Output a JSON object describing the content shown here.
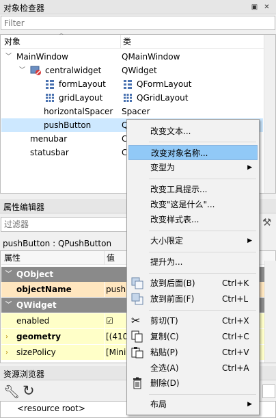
{
  "object_inspector": {
    "title": "对象检查器",
    "filter_placeholder": "Filter",
    "col_object": "对象",
    "col_class": "类",
    "rows": [
      {
        "name": "MainWindow",
        "cls": "QMainWindow"
      },
      {
        "name": "centralwidget",
        "cls": "QWidget"
      },
      {
        "name": "formLayout",
        "cls": "QFormLayout"
      },
      {
        "name": "gridLayout",
        "cls": "QGridLayout"
      },
      {
        "name": "horizontalSpacer",
        "cls": "Spacer"
      },
      {
        "name": "pushButton",
        "cls": "QPushButton"
      },
      {
        "name": "menubar",
        "cls": "C"
      },
      {
        "name": "statusbar",
        "cls": "C"
      }
    ]
  },
  "property_editor": {
    "title": "属性编辑器",
    "filter_placeholder": "过滤器",
    "object_label": "pushButton : QPushButton",
    "col_property": "属性",
    "col_value": "值",
    "groups": [
      "QObject",
      "QWidget"
    ],
    "props": [
      {
        "name": "objectName",
        "value": "push"
      },
      {
        "name": "enabled",
        "value": "☑"
      },
      {
        "name": "geometry",
        "value": "[(410,"
      },
      {
        "name": "sizePolicy",
        "value": "[Mini"
      }
    ]
  },
  "resource_browser": {
    "title": "资源浏览器",
    "root": "<resource root>"
  },
  "context_menu": {
    "items": [
      {
        "label": "改变文本..."
      },
      {
        "label": "改变对象名称..."
      },
      {
        "label": "变型为"
      },
      {
        "label": "改变工具提示..."
      },
      {
        "label": "改变\"这是什么\"..."
      },
      {
        "label": "改变样式表..."
      },
      {
        "label": "大小限定"
      },
      {
        "label": "提升为..."
      },
      {
        "label": "放到后面(B)",
        "shortcut": "Ctrl+K"
      },
      {
        "label": "放到前面(F)",
        "shortcut": "Ctrl+L"
      },
      {
        "label": "剪切(T)",
        "shortcut": "Ctrl+X"
      },
      {
        "label": "复制(C)",
        "shortcut": "Ctrl+C"
      },
      {
        "label": "粘贴(P)",
        "shortcut": "Ctrl+V"
      },
      {
        "label": "全选(A)",
        "shortcut": "Ctrl+A"
      },
      {
        "label": "删除(D)"
      },
      {
        "label": "布局"
      }
    ]
  }
}
